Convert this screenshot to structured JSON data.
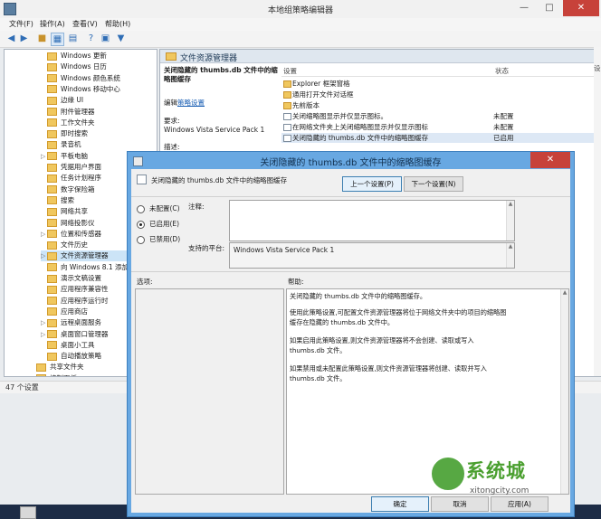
{
  "window": {
    "title": "本地组策略编辑器"
  },
  "menu": [
    "文件(F)",
    "操作(A)",
    "查看(V)",
    "帮助(H)"
  ],
  "tree": {
    "items": [
      {
        "label": "Windows 更新",
        "expander": ""
      },
      {
        "label": "Windows 日历",
        "expander": ""
      },
      {
        "label": "Windows 颜色系统",
        "expander": ""
      },
      {
        "label": "Windows 移动中心",
        "expander": ""
      },
      {
        "label": "边缘 UI",
        "expander": ""
      },
      {
        "label": "附件管理器",
        "expander": ""
      },
      {
        "label": "工作文件夹",
        "expander": ""
      },
      {
        "label": "即时搜索",
        "expander": ""
      },
      {
        "label": "录音机",
        "expander": ""
      },
      {
        "label": "平板电脑",
        "expander": "▷"
      },
      {
        "label": "凭据用户界面",
        "expander": ""
      },
      {
        "label": "任务计划程序",
        "expander": ""
      },
      {
        "label": "数字保险箱",
        "expander": ""
      },
      {
        "label": "搜索",
        "expander": ""
      },
      {
        "label": "网络共享",
        "expander": ""
      },
      {
        "label": "网络投影仪",
        "expander": ""
      },
      {
        "label": "位置和传感器",
        "expander": "▷"
      },
      {
        "label": "文件历史",
        "expander": ""
      },
      {
        "label": "文件资源管理器",
        "expander": "▷",
        "selected": true
      },
      {
        "label": "向 Windows 8.1 添加",
        "expander": ""
      },
      {
        "label": "演示文稿设置",
        "expander": ""
      },
      {
        "label": "应用程序兼容性",
        "expander": ""
      },
      {
        "label": "应用程序运行时",
        "expander": ""
      },
      {
        "label": "应用商店",
        "expander": ""
      },
      {
        "label": "远程桌面服务",
        "expander": "▷"
      },
      {
        "label": "桌面窗口管理器",
        "expander": "▷"
      },
      {
        "label": "桌面小工具",
        "expander": ""
      },
      {
        "label": "自动播放策略",
        "expander": ""
      },
      {
        "label": "共享文件夹",
        "expander": "",
        "parent": true
      },
      {
        "label": "控制面板",
        "expander": "▷",
        "parent": true
      }
    ]
  },
  "status": {
    "text": "47 个设置"
  },
  "right_pane": {
    "header": "文件资源管理器",
    "extended": {
      "title": "关闭隐藏的 thumbs.db 文件中的缩略图缓存",
      "edit_prefix": "编辑",
      "edit_link": "策略设置",
      "requirements_label": "要求:",
      "requirements_value": "Windows Vista Service Pack 1",
      "description_label": "描述:"
    },
    "columns": {
      "setting": "设置",
      "state": "状态"
    },
    "rows": [
      {
        "icon": "folder",
        "name": "Explorer 框架窗格",
        "state": ""
      },
      {
        "icon": "folder",
        "name": "通用打开文件对话框",
        "state": ""
      },
      {
        "icon": "folder",
        "name": "先前版本",
        "state": ""
      },
      {
        "icon": "setting",
        "name": "关闭缩略图显示并仅显示图标。",
        "state": "未配置"
      },
      {
        "icon": "setting",
        "name": "在网络文件夹上关闭缩略图显示并仅显示图标",
        "state": "未配置"
      },
      {
        "icon": "setting",
        "name": "关闭隐藏的 thumbs.db 文件中的缩略图缓存",
        "state": "已启用",
        "selected": true
      }
    ],
    "edge_text": "设"
  },
  "dialog": {
    "title": "关闭隐藏的 thumbs.db 文件中的缩略图缓存",
    "policy_name": "关闭隐藏的 thumbs.db 文件中的缩略图缓存",
    "prev_button": "上一个设置(P)",
    "next_button": "下一个设置(N)",
    "options": [
      {
        "label": "未配置(C)",
        "checked": false
      },
      {
        "label": "已启用(E)",
        "checked": true
      },
      {
        "label": "已禁用(D)",
        "checked": false
      }
    ],
    "comment_label": "注释:",
    "supported_label": "支持的平台:",
    "supported_value": "Windows Vista Service Pack 1",
    "options_label": "选项:",
    "help_label": "帮助:",
    "help_paragraphs": [
      "关闭隐藏的 thumbs.db 文件中的缩略图缓存。",
      "使用此策略设置,可配置文件资源管理器将位于网络文件夹中的项目的缩略图缓存在隐藏的 thumbs.db 文件中。",
      "如果启用此策略设置,则文件资源管理器将不会创建、读取或写入 thumbs.db 文件。",
      "如果禁用或未配置此策略设置,则文件资源管理器将创建、读取并写入 thumbs.db 文件。"
    ],
    "ok_button": "确定",
    "cancel_button": "取消",
    "apply_button": "应用(A)"
  },
  "watermark": {
    "text": "系统城",
    "url": "xitongcity.com"
  }
}
